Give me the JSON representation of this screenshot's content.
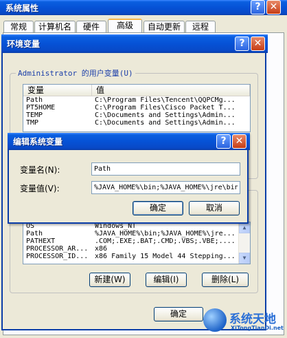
{
  "sys_window": {
    "title": "系统属性",
    "tabs": [
      "常规",
      "计算机名",
      "硬件",
      "高级",
      "自动更新",
      "远程"
    ],
    "active_tab": "高级"
  },
  "env_window": {
    "title": "环境变量",
    "user_group_label": "Administrator 的用户变量(U)",
    "columns": [
      "变量",
      "值"
    ],
    "user_vars": [
      [
        "Path",
        "C:\\Program Files\\Tencent\\QQPCMg..."
      ],
      [
        "PT5HOME",
        "C:\\Program Files\\Cisco Packet T..."
      ],
      [
        "TEMP",
        "C:\\Documents and Settings\\Admin..."
      ],
      [
        "TMP",
        "C:\\Documents and Settings\\Admin..."
      ]
    ],
    "system_vars": [
      [
        "OS",
        "Windows_NT"
      ],
      [
        "Path",
        "%JAVA_HOME%\\bin;%JAVA_HOME%\\jre..."
      ],
      [
        "PATHEXT",
        ".COM;.EXE;.BAT;.CMD;.VBS;.VBE;...."
      ],
      [
        "PROCESSOR_AR...",
        "x86"
      ],
      [
        "PROCESSOR_ID...",
        "x86 Family 15 Model 44 Stepping..."
      ]
    ],
    "new_button": "新建(W)",
    "edit_button": "编辑(I)",
    "delete_button": "删除(L)",
    "ok_button": "确定"
  },
  "edit_dialog": {
    "title": "编辑系统变量",
    "name_label": "变量名(N):",
    "value_label": "变量值(V):",
    "name_value": "Path",
    "value_value": "%JAVA_HOME%\\bin;%JAVA_HOME%\\jre\\bin",
    "ok_button": "确定",
    "cancel_button": "取消"
  },
  "watermark": {
    "brand": "系统天地",
    "url": "XiTongTianDi.net"
  },
  "icons": {
    "help": "?",
    "close": "✕",
    "scroll_up": "▲",
    "scroll_down": "▼"
  },
  "colors": {
    "titlebar": "#0652d6",
    "dialog_bg": "#ece9d8",
    "group_label": "#1c3fa9"
  }
}
